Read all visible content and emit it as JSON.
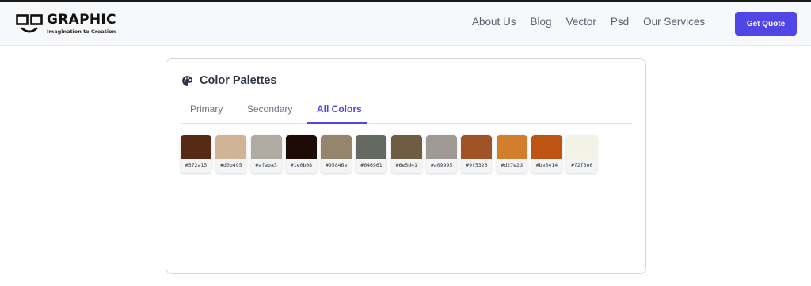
{
  "header": {
    "logo_name": "GRAPHIC",
    "logo_tagline": "Imagination to Creation",
    "nav": [
      "About Us",
      "Blog",
      "Vector",
      "Psd",
      "Our Services"
    ],
    "cta_label": "Get Quote",
    "accent": "#4f46e5"
  },
  "panel": {
    "icon": "palette-icon",
    "title": "Color Palettes",
    "tabs": [
      "Primary",
      "Secondary",
      "All Colors"
    ],
    "active_tab": "All Colors",
    "swatches": [
      {
        "color": "#572a15",
        "label": "#572a15"
      },
      {
        "color": "#d0b495",
        "label": "#d0b495"
      },
      {
        "color": "#afaba3",
        "label": "#afaba3"
      },
      {
        "color": "#1e0b08",
        "label": "#1e0b08"
      },
      {
        "color": "#95846e",
        "label": "#95846e"
      },
      {
        "color": "#646961",
        "label": "#646961"
      },
      {
        "color": "#6e5d41",
        "label": "#6e5d41"
      },
      {
        "color": "#a09995",
        "label": "#a09995"
      },
      {
        "color": "#9f5326",
        "label": "#9f5326"
      },
      {
        "color": "#d27e2d",
        "label": "#d27e2d"
      },
      {
        "color": "#be5414",
        "label": "#be5414"
      },
      {
        "color": "#f2f3e6",
        "label": "#f2f3e6"
      }
    ]
  }
}
